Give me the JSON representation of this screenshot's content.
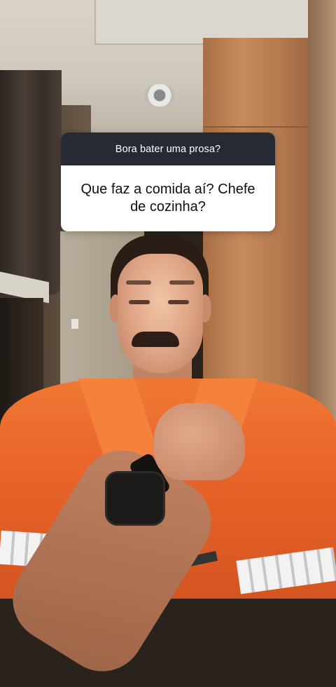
{
  "question_sticker": {
    "prompt": "Bora bater uma prosa?",
    "answer": "Que faz a comida aí? Chefe de cozinha?"
  },
  "colors": {
    "sticker_header": "#262a33",
    "sticker_body": "#ffffff",
    "coverall": "#e9652a"
  }
}
